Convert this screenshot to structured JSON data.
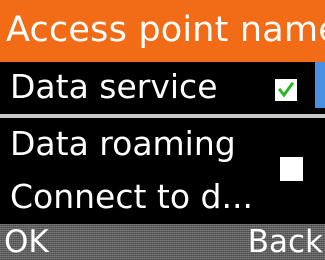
{
  "header": {
    "title": "Access point name"
  },
  "options": {
    "data_service": {
      "label": "Data service",
      "checked": true
    },
    "data_roaming": {
      "label": "Data roaming",
      "description": "Connect to d...",
      "checked": false
    }
  },
  "softkeys": {
    "left": "OK",
    "right": "Back"
  },
  "colors": {
    "header_background": "#f26b16",
    "check_mark": "#2db52d",
    "scrollbar": "#4a90e2"
  },
  "icons": {
    "checked": "checkbox-checked-icon",
    "unchecked": "checkbox-unchecked-icon"
  }
}
